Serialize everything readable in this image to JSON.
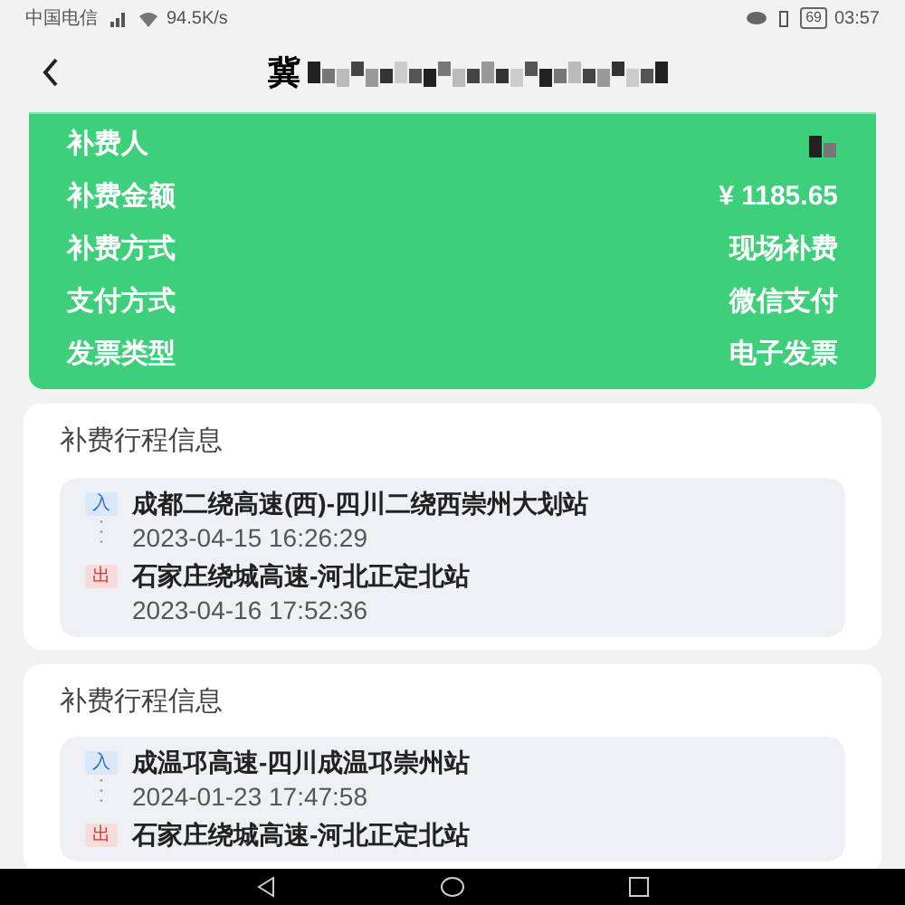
{
  "status_bar": {
    "carrier": "中国电信",
    "speed": "94.5K/s",
    "battery": "69",
    "time": "03:57"
  },
  "header": {
    "title": "冀"
  },
  "summary": [
    {
      "label": "补费人",
      "kind": "redacted"
    },
    {
      "label": "补费金额",
      "kind": "text",
      "value": "¥ 1185.65"
    },
    {
      "label": "补费方式",
      "kind": "text",
      "value": "现场补费"
    },
    {
      "label": "支付方式",
      "kind": "text",
      "value": "微信支付"
    },
    {
      "label": "发票类型",
      "kind": "text",
      "value": "电子发票"
    }
  ],
  "trips": [
    {
      "title": "补费行程信息",
      "stops": [
        {
          "kind": "entry",
          "badge": "入",
          "place": "成都二绕高速(西)-四川二绕西崇州大划站",
          "time": "2023-04-15 16:26:29"
        },
        {
          "kind": "exit",
          "badge": "出",
          "place": "石家庄绕城高速-河北正定北站",
          "time": "2023-04-16 17:52:36"
        }
      ]
    },
    {
      "title": "补费行程信息",
      "stops": [
        {
          "kind": "entry",
          "badge": "入",
          "place": "成温邛高速-四川成温邛崇州站",
          "time": "2024-01-23 17:47:58"
        },
        {
          "kind": "exit",
          "badge": "出",
          "place": "石家庄绕城高速-河北正定北站"
        }
      ]
    }
  ]
}
